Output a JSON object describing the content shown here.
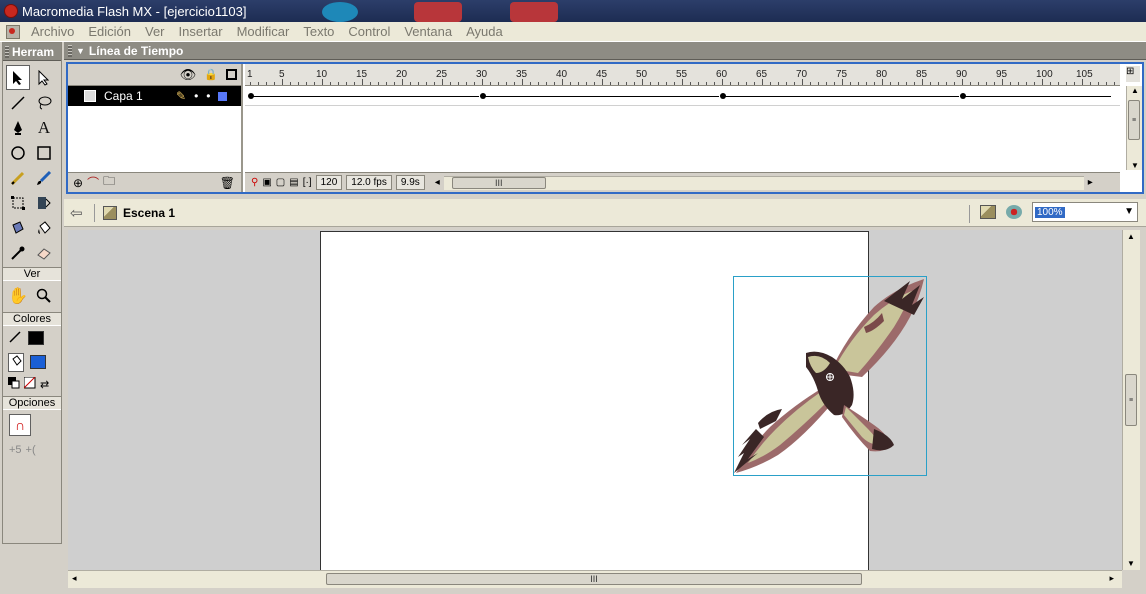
{
  "window": {
    "title": "Macromedia Flash MX - [ejercicio1103]"
  },
  "menu": [
    "Archivo",
    "Edición",
    "Ver",
    "Insertar",
    "Modificar",
    "Texto",
    "Control",
    "Ventana",
    "Ayuda"
  ],
  "tools_panel": {
    "title": "Herram",
    "view_label": "Ver",
    "colors_label": "Colores",
    "options_label": "Opciones",
    "stroke_color": "#000000",
    "fill_color": "#1a5fd6"
  },
  "timeline": {
    "title": "Línea de Tiempo",
    "layer_name": "Capa 1",
    "ruler_labels": [
      "1",
      "5",
      "10",
      "15",
      "20",
      "25",
      "30",
      "35",
      "40",
      "45",
      "50",
      "55",
      "60",
      "65",
      "70",
      "75",
      "80",
      "85",
      "90",
      "95",
      "100",
      "105"
    ],
    "keyframes": [
      1,
      30,
      60,
      90
    ],
    "current_frame": "120",
    "frame_rate": "12.0 fps",
    "elapsed_time": "9.9s"
  },
  "editbar": {
    "scene_label": "Escena 1",
    "zoom_value": "100%"
  },
  "colors": {
    "accent": "#316ac5",
    "title_bar": "#1d2c52",
    "panel_header": "#8e8c84",
    "bird_light": "#c9c59a",
    "bird_mid": "#9c6a6a",
    "bird_dark": "#3a2626"
  }
}
